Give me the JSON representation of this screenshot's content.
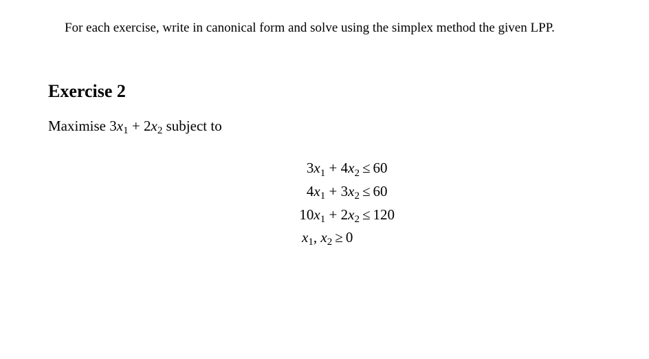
{
  "intro": "For each exercise, write in canonical form and solve using the simplex method the given LPP.",
  "heading": "Exercise 2",
  "objective": {
    "prefix": "Maximise ",
    "c1": "3",
    "v1": "x",
    "s1": "1",
    "plus": " + ",
    "c2": "2",
    "v2": "x",
    "s2": "2",
    "suffix": " subject to"
  },
  "constraints": [
    {
      "a1": "3",
      "a2": "4",
      "rhs": "60"
    },
    {
      "a1": "4",
      "a2": "3",
      "rhs": "60"
    },
    {
      "a1": "10",
      "a2": "2",
      "rhs": "120"
    }
  ],
  "sym": {
    "x": "x",
    "sub1": "1",
    "sub2": "2",
    "plus": " + ",
    "le": "≤",
    "ge": "≥",
    "comma": ", ",
    "zero": "0"
  }
}
